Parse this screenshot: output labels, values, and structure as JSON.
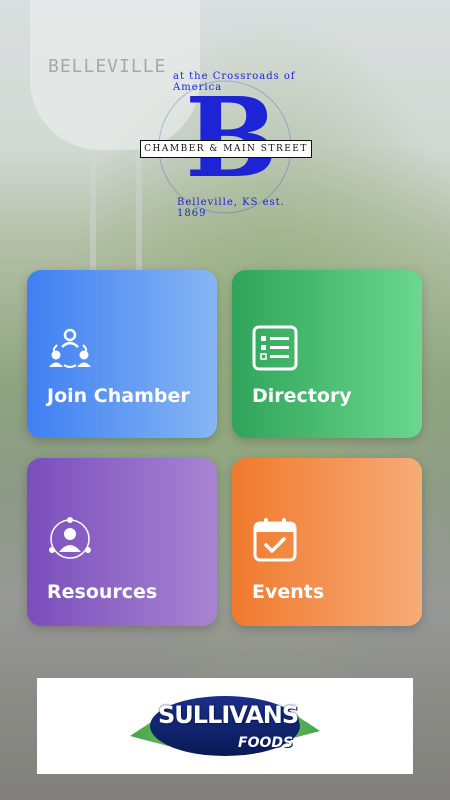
{
  "background": {
    "tower_text": "BELLEVILLE"
  },
  "logo": {
    "letter": "B",
    "banner": "CHAMBER & MAIN STREET",
    "top_text": "at the Crossroads of America",
    "bottom_text": "Belleville, KS est. 1869",
    "color": "#1c24d6"
  },
  "tiles": [
    {
      "label": "Join Chamber",
      "icon": "group-icon",
      "color_from": "#3f7ff2",
      "color_to": "#86b6f5"
    },
    {
      "label": "Directory",
      "icon": "list-icon",
      "color_from": "#2fa45a",
      "color_to": "#6ad88e"
    },
    {
      "label": "Resources",
      "icon": "person-network-icon",
      "color_from": "#7a4ebc",
      "color_to": "#a884d2"
    },
    {
      "label": "Events",
      "icon": "calendar-check-icon",
      "color_from": "#f07a2e",
      "color_to": "#f6ac76"
    }
  ],
  "sponsor": {
    "name": "SULLIVANS",
    "sub": "FOODS"
  }
}
